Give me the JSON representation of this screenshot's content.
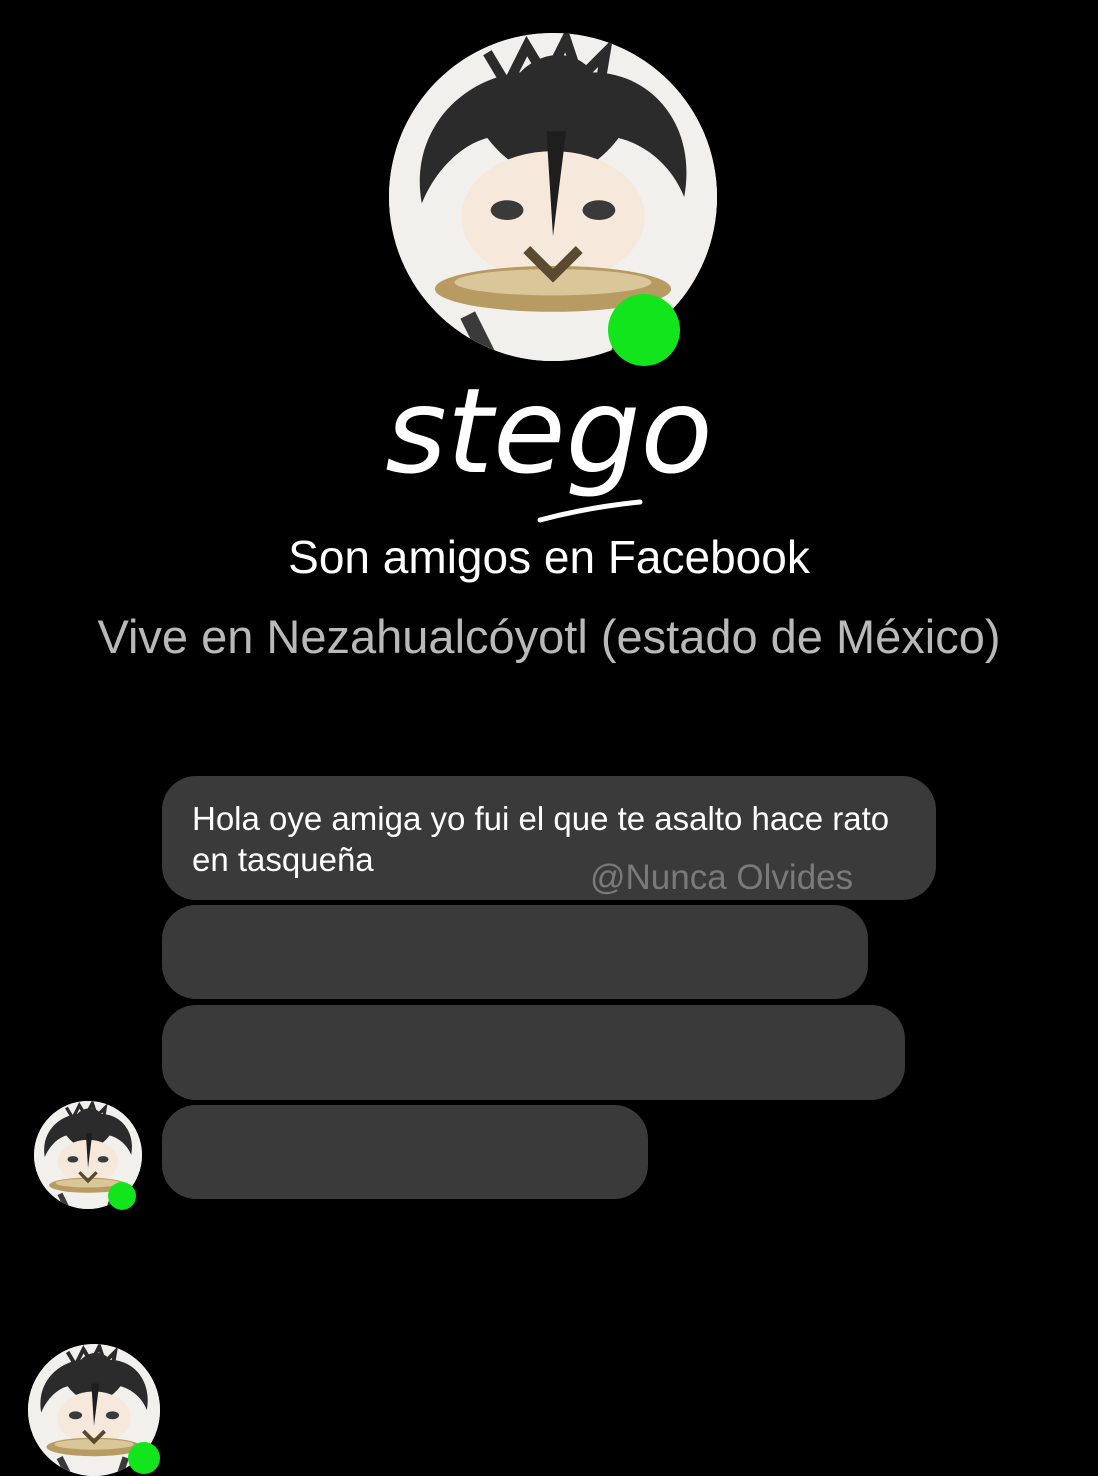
{
  "profile": {
    "name": "stego",
    "friends_text": "Son amigos en Facebook",
    "lives_text": "Vive en Nezahualcóyotl (estado de México)",
    "avatar_icon": "chibi-character-avatar",
    "online_color": "#13e51c"
  },
  "messages": [
    {
      "text": "Hola oye amiga yo fui el que te asalto hace rato en tasqueña",
      "redacted": false
    },
    {
      "text": "",
      "redacted": true
    },
    {
      "text": "",
      "redacted": true
    },
    {
      "text": "",
      "redacted": true
    }
  ],
  "watermark": "@Nunca Olvides",
  "colors": {
    "background": "#000000",
    "bubble": "#3a3a3a",
    "secondary_text": "#b9b9b9",
    "online": "#13e51c"
  }
}
